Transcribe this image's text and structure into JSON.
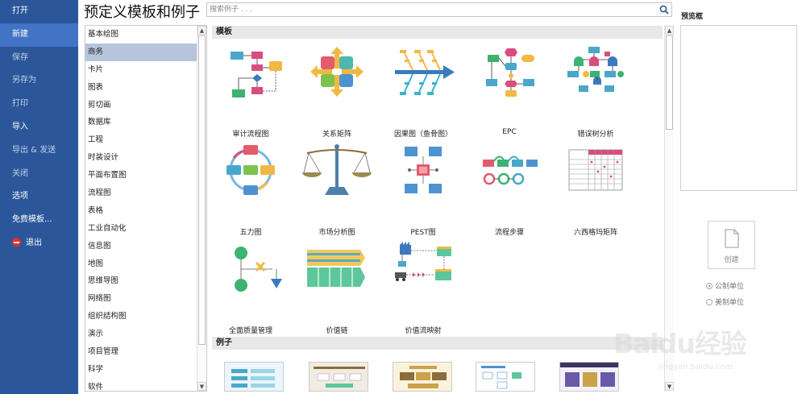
{
  "nav": {
    "items": [
      {
        "label": "打开"
      },
      {
        "label": "新建"
      },
      {
        "label": "保存"
      },
      {
        "label": "另存为"
      },
      {
        "label": "打印"
      },
      {
        "label": "导入"
      },
      {
        "label": "导出 & 发送"
      },
      {
        "label": "关闭"
      },
      {
        "label": "选项"
      },
      {
        "label": "免费模板..."
      }
    ],
    "exit_label": "退出",
    "active": "新建"
  },
  "header": {
    "title": "预定义模板和例子",
    "search_placeholder": "搜索例子 . . ."
  },
  "categories": {
    "items": [
      "基本绘图",
      "商务",
      "卡片",
      "图表",
      "剪切画",
      "数据库",
      "工程",
      "时装设计",
      "平面布置图",
      "流程图",
      "表格",
      "工业自动化",
      "信息图",
      "地图",
      "思维导图",
      "网络图",
      "组织结构图",
      "演示",
      "项目管理",
      "科学",
      "软件"
    ],
    "selected": "商务"
  },
  "templates": {
    "section_label": "模板",
    "items": [
      {
        "label": "审计流程图",
        "icon": "audit-flowchart-icon"
      },
      {
        "label": "关系矩阵",
        "icon": "relationship-matrix-icon"
      },
      {
        "label": "因果图（鱼骨图）",
        "icon": "fishbone-diagram-icon"
      },
      {
        "label": "EPC",
        "icon": "epc-diagram-icon"
      },
      {
        "label": "错误树分析",
        "icon": "fault-tree-icon"
      },
      {
        "label": "五力图",
        "icon": "five-forces-icon"
      },
      {
        "label": "市场分析图",
        "icon": "balance-scale-icon"
      },
      {
        "label": "PEST图",
        "icon": "pest-diagram-icon"
      },
      {
        "label": "流程步骤",
        "icon": "process-steps-icon"
      },
      {
        "label": "六西格玛矩阵",
        "icon": "six-sigma-matrix-icon"
      },
      {
        "label": "全面质量管理",
        "icon": "tqm-diagram-icon"
      },
      {
        "label": "价值链",
        "icon": "value-chain-icon"
      },
      {
        "label": "价值流映射",
        "icon": "value-stream-map-icon"
      }
    ]
  },
  "examples": {
    "section_label": "例子"
  },
  "preview": {
    "title": "预览框",
    "create_label": "创建",
    "units": [
      {
        "label": "公制单位",
        "checked": true
      },
      {
        "label": "美制单位",
        "checked": false
      }
    ]
  },
  "watermark": {
    "brand": "Baidu经验",
    "url": "jingyan.baidu.com"
  },
  "colors": {
    "nav_bg": "#2b579a",
    "nav_active": "#4174c4",
    "selected_category": "#b6c4dc"
  }
}
